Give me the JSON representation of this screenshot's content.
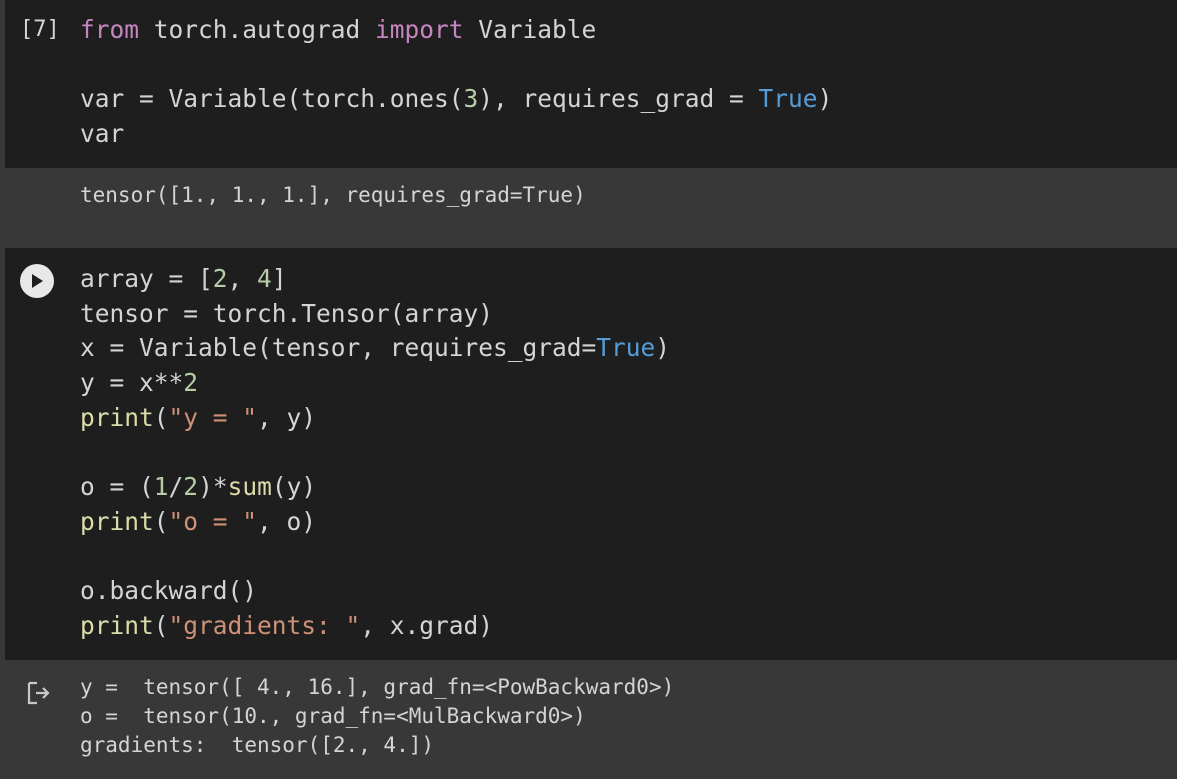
{
  "cells": [
    {
      "exec_count": "[7]",
      "code_lines": [
        [
          {
            "t": "from",
            "c": "kw"
          },
          {
            "t": " torch.autograd ",
            "c": ""
          },
          {
            "t": "import",
            "c": "kw"
          },
          {
            "t": " Variable",
            "c": ""
          }
        ],
        [],
        [
          {
            "t": "var = Variable(torch.ones(",
            "c": ""
          },
          {
            "t": "3",
            "c": "num"
          },
          {
            "t": "), requires_grad = ",
            "c": ""
          },
          {
            "t": "True",
            "c": "const"
          },
          {
            "t": ")",
            "c": ""
          }
        ],
        [
          {
            "t": "var",
            "c": ""
          }
        ]
      ],
      "output_lines": [
        "tensor([1., 1., 1.], requires_grad=True)"
      ]
    },
    {
      "run_button": "play-icon",
      "code_lines": [
        [
          {
            "t": "array = [",
            "c": ""
          },
          {
            "t": "2",
            "c": "num"
          },
          {
            "t": ", ",
            "c": ""
          },
          {
            "t": "4",
            "c": "num"
          },
          {
            "t": "]",
            "c": ""
          }
        ],
        [
          {
            "t": "tensor = torch.Tensor(array)",
            "c": ""
          }
        ],
        [
          {
            "t": "x = Variable(tensor, requires_grad=",
            "c": ""
          },
          {
            "t": "True",
            "c": "const"
          },
          {
            "t": ")",
            "c": ""
          }
        ],
        [
          {
            "t": "y = x**",
            "c": ""
          },
          {
            "t": "2",
            "c": "num"
          }
        ],
        [
          {
            "t": "print",
            "c": "fn"
          },
          {
            "t": "(",
            "c": ""
          },
          {
            "t": "\"y = \"",
            "c": "str"
          },
          {
            "t": ", y)",
            "c": ""
          }
        ],
        [],
        [
          {
            "t": "o = (",
            "c": ""
          },
          {
            "t": "1",
            "c": "num"
          },
          {
            "t": "/",
            "c": ""
          },
          {
            "t": "2",
            "c": "num"
          },
          {
            "t": ")*",
            "c": ""
          },
          {
            "t": "sum",
            "c": "fn"
          },
          {
            "t": "(y)",
            "c": ""
          }
        ],
        [
          {
            "t": "print",
            "c": "fn"
          },
          {
            "t": "(",
            "c": ""
          },
          {
            "t": "\"o = \"",
            "c": "str"
          },
          {
            "t": ", o)",
            "c": ""
          }
        ],
        [],
        [
          {
            "t": "o.backward()",
            "c": ""
          }
        ],
        [
          {
            "t": "print",
            "c": "fn"
          },
          {
            "t": "(",
            "c": ""
          },
          {
            "t": "\"gradients: \"",
            "c": "str"
          },
          {
            "t": ", x.grad)",
            "c": ""
          }
        ]
      ],
      "output_icon": "output-redirect-icon",
      "output_lines": [
        "y =  tensor([ 4., 16.], grad_fn=<PowBackward0>)",
        "o =  tensor(10., grad_fn=<MulBackward0>)",
        "gradients:  tensor([2., 4.])"
      ]
    }
  ],
  "colors": {
    "background": "#383838",
    "code_background": "#1e1e1e",
    "keyword": "#c586c0",
    "constant": "#569cd6",
    "number": "#b5cea8",
    "function": "#dcdcaa",
    "string": "#ce9178",
    "text": "#d4d4d4"
  }
}
